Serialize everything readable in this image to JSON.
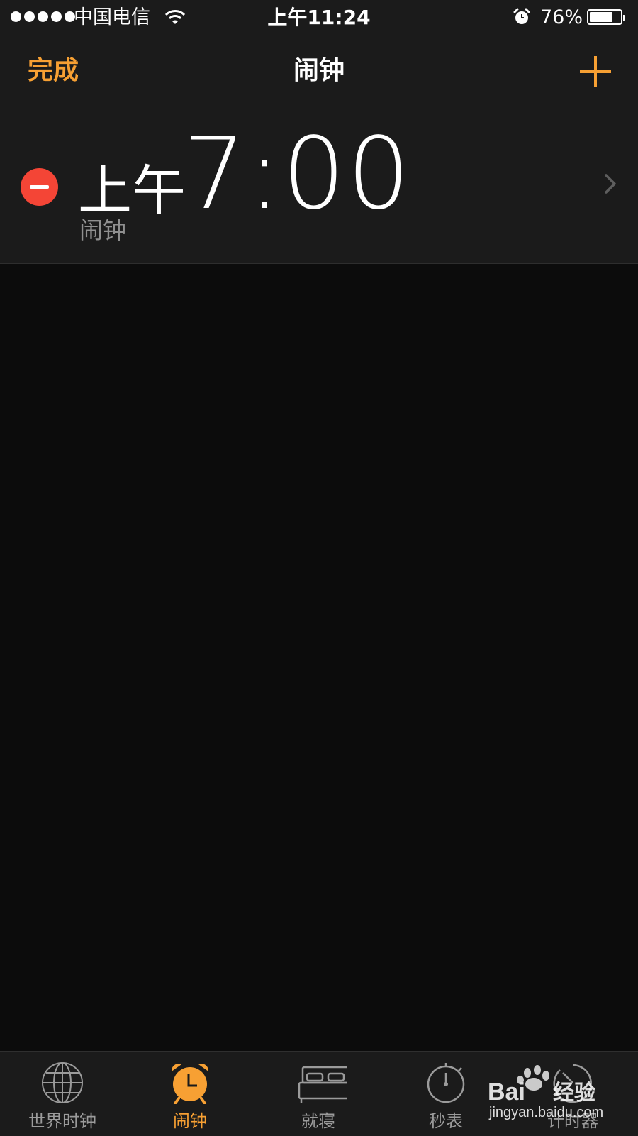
{
  "status_bar": {
    "carrier": "中国电信",
    "time": "上午11:24",
    "battery_percent": "76%",
    "battery_level": 0.76,
    "icons": [
      "signal-dots-icon",
      "wifi-icon",
      "alarm-status-icon",
      "battery-icon"
    ]
  },
  "nav": {
    "done_label": "完成",
    "title": "闹钟",
    "add_icon": "plus-icon"
  },
  "alarms": [
    {
      "ampm": "上午",
      "time": "7:00",
      "label": "闹钟"
    }
  ],
  "tabs": [
    {
      "label": "世界时钟",
      "icon": "globe-icon",
      "active": false
    },
    {
      "label": "闹钟",
      "icon": "alarm-clock-icon",
      "active": true
    },
    {
      "label": "就寝",
      "icon": "bed-icon",
      "active": false
    },
    {
      "label": "秒表",
      "icon": "stopwatch-icon",
      "active": false
    },
    {
      "label": "计时器",
      "icon": "timer-icon",
      "active": false
    }
  ],
  "watermark": {
    "brand": "Baidu经验",
    "url": "jingyan.baidu.com"
  },
  "colors": {
    "accent": "#f7a033",
    "delete": "#f44536",
    "background": "#0c0c0c",
    "bar": "#1b1b1b",
    "secondary_text": "#8f8f8f"
  }
}
